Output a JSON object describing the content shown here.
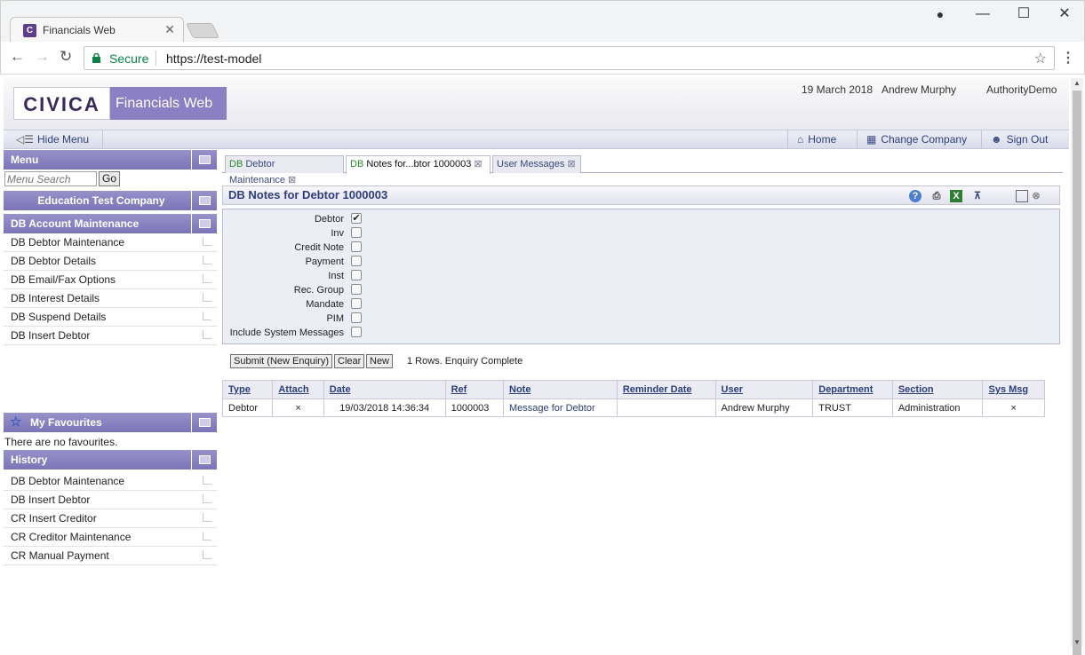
{
  "browser": {
    "tab_title": "Financials Web",
    "tab_favicon_letter": "C",
    "secure_label": "Secure",
    "url": "https://test-model"
  },
  "header": {
    "logo": "CIVICA",
    "brand": "Financials Web",
    "date": "19 March 2018",
    "user": "Andrew Murphy",
    "authority": "AuthorityDemo"
  },
  "toolbar": {
    "hide_menu": "Hide Menu",
    "home": "Home",
    "change_company": "Change Company",
    "sign_out": "Sign Out"
  },
  "sidebar": {
    "menu_title": "Menu",
    "search_placeholder": "Menu Search",
    "go_label": "Go",
    "company": "Education Test Company",
    "section_title": "DB Account Maintenance",
    "items": [
      {
        "label": "DB Debtor Maintenance"
      },
      {
        "label": "DB Debtor Details"
      },
      {
        "label": "DB Email/Fax Options"
      },
      {
        "label": "DB Interest Details"
      },
      {
        "label": "DB Suspend Details"
      },
      {
        "label": "DB Insert Debtor"
      }
    ],
    "favourites_title": "My Favourites",
    "no_favourites": "There are no favourites.",
    "history_title": "History",
    "history": [
      {
        "label": "DB Debtor Maintenance"
      },
      {
        "label": "DB Insert Debtor"
      },
      {
        "label": "CR Insert Creditor"
      },
      {
        "label": "CR Creditor Maintenance"
      },
      {
        "label": "CR Manual Payment"
      }
    ]
  },
  "tabs": [
    {
      "code": "DB",
      "label": "Debtor Maintenance",
      "active": false
    },
    {
      "code": "DB",
      "label": "Notes for...btor 1000003",
      "active": true
    },
    {
      "code": "",
      "label": "User Messages",
      "active": false
    }
  ],
  "panel": {
    "title": "DB Notes for Debtor 1000003"
  },
  "filters": [
    {
      "label": "Debtor",
      "checked": true
    },
    {
      "label": "Inv",
      "checked": false
    },
    {
      "label": "Credit Note",
      "checked": false
    },
    {
      "label": "Payment",
      "checked": false
    },
    {
      "label": "Inst",
      "checked": false
    },
    {
      "label": "Rec. Group",
      "checked": false
    },
    {
      "label": "Mandate",
      "checked": false
    },
    {
      "label": "PIM",
      "checked": false
    },
    {
      "label": "Include System Messages",
      "checked": false
    }
  ],
  "actions": {
    "submit": "Submit (New Enquiry)",
    "clear": "Clear",
    "new": "New",
    "status": "1 Rows. Enquiry Complete"
  },
  "grid": {
    "columns": [
      "Type",
      "Attach",
      "Date",
      "Ref",
      "Note",
      "Reminder Date",
      "User",
      "Department",
      "Section",
      "Sys Msg"
    ],
    "rows": [
      {
        "type": "Debtor",
        "attach": "×",
        "date": "19/03/2018 14:36:34",
        "ref": "1000003",
        "note": "Message for Debtor",
        "reminder_date": "",
        "user": "Andrew Murphy",
        "department": "TRUST",
        "section": "Administration",
        "sys_msg": "×"
      }
    ]
  }
}
